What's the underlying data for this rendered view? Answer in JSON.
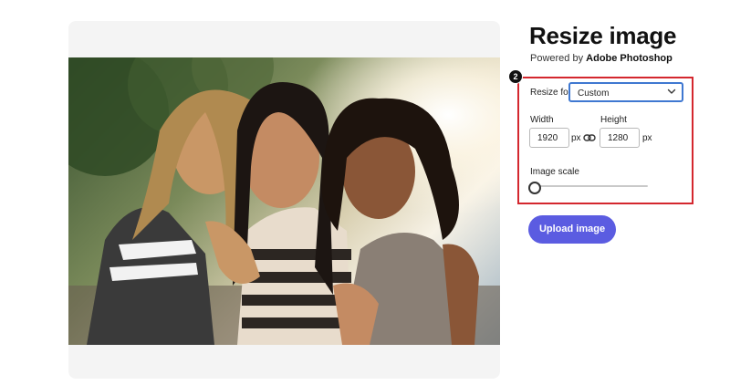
{
  "header": {
    "title": "Resize image",
    "powered_prefix": "Powered by",
    "powered_brand": "Adobe Photoshop"
  },
  "step_badge": "2",
  "resize": {
    "label": "Resize for:",
    "selected": "Custom"
  },
  "dimensions": {
    "width_label": "Width",
    "width_value": "1920",
    "height_label": "Height",
    "height_value": "1280",
    "unit": "px"
  },
  "scale": {
    "label": "Image scale",
    "level": 0
  },
  "upload_button": "Upload image",
  "colors": {
    "accent": "#5b5ce1",
    "highlight_box": "#d4272e",
    "focus_border": "#3f78d1"
  },
  "icons": [
    "chevron-down-icon",
    "link-icon"
  ]
}
